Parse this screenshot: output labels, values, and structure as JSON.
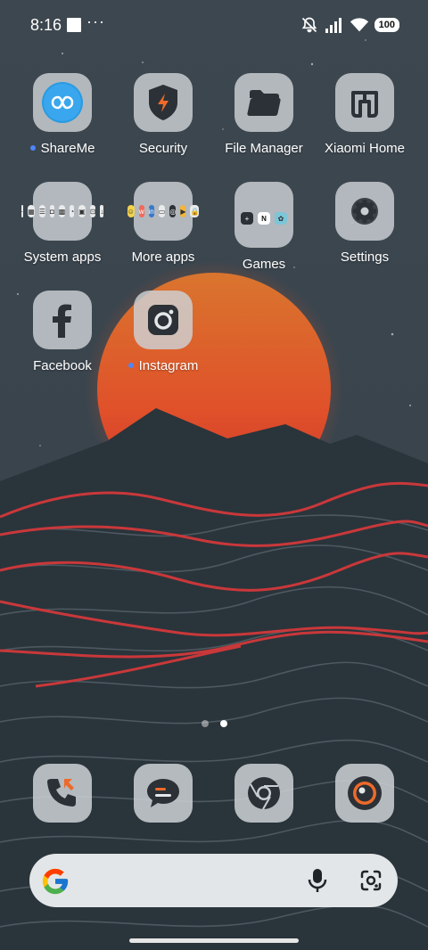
{
  "status_bar": {
    "time": "8:16",
    "more_indicator": "···",
    "battery": "100",
    "icons": [
      "silent-icon",
      "signal-icon",
      "wifi-icon",
      "battery-icon"
    ]
  },
  "home": {
    "apps": [
      {
        "label": "ShareMe",
        "new_dot": true,
        "icon": "shareme-icon"
      },
      {
        "label": "Security",
        "new_dot": false,
        "icon": "security-icon"
      },
      {
        "label": "File Manager",
        "new_dot": false,
        "icon": "folder-icon"
      },
      {
        "label": "Xiaomi Home",
        "new_dot": false,
        "icon": "mi-home-icon"
      },
      {
        "label": "System apps",
        "new_dot": false,
        "icon": "folder-system-apps"
      },
      {
        "label": "More apps",
        "new_dot": false,
        "icon": "folder-more-apps"
      },
      {
        "label": "Games",
        "new_dot": false,
        "icon": "folder-games"
      },
      {
        "label": "Settings",
        "new_dot": false,
        "icon": "gear-icon"
      },
      {
        "label": "Facebook",
        "new_dot": false,
        "icon": "facebook-icon"
      },
      {
        "label": "Instagram",
        "new_dot": true,
        "icon": "instagram-icon"
      }
    ],
    "page_indicator": {
      "pages": 2,
      "current": 2
    }
  },
  "dock": {
    "apps": [
      "phone-icon",
      "messages-icon",
      "chrome-icon",
      "camera-icon"
    ]
  },
  "search_bar": {
    "icons": [
      "google-logo",
      "mic-icon",
      "lens-icon"
    ]
  },
  "colors": {
    "accent_dot": "#4f86f7",
    "sun": "#e0562a",
    "wave": "#c9383a",
    "sky": "#3a454d"
  }
}
